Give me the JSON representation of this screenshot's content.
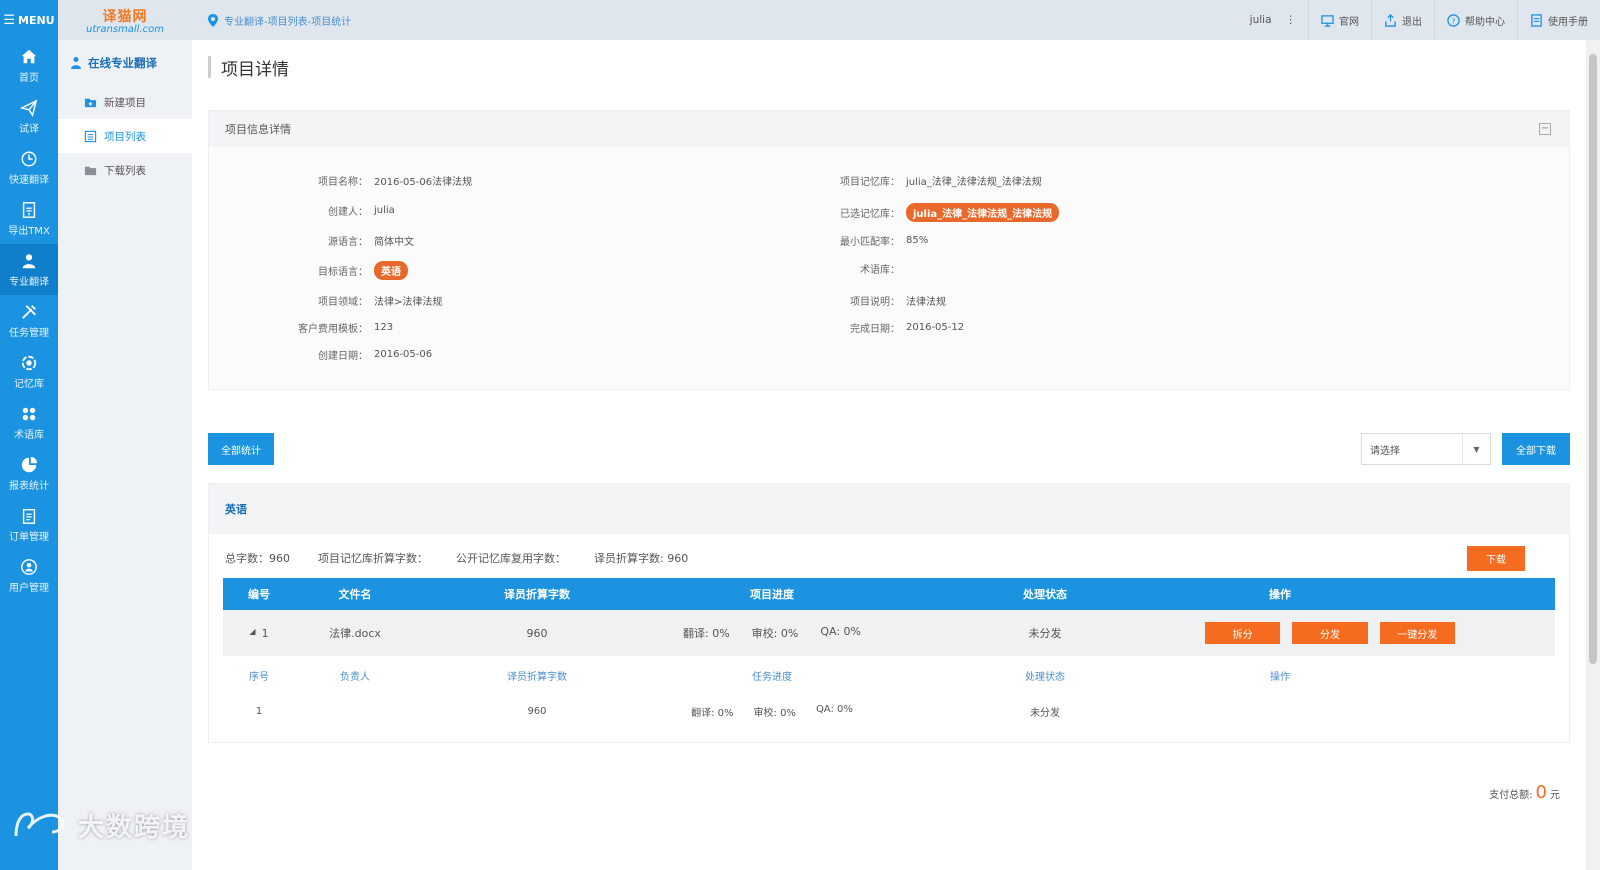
{
  "menu_label": "MENU",
  "logo": {
    "cn": "译猫网",
    "en": "utransmall.com"
  },
  "breadcrumb": "专业翻译-项目列表-项目统计",
  "topbar": {
    "user": "julia",
    "links": [
      {
        "icon": "monitor-icon",
        "label": "官网"
      },
      {
        "icon": "logout-icon",
        "label": "退出"
      },
      {
        "icon": "help-icon",
        "label": "帮助中心"
      },
      {
        "icon": "manual-icon",
        "label": "使用手册"
      }
    ]
  },
  "rail": [
    {
      "icon": "home-icon",
      "label": "首页"
    },
    {
      "icon": "paper-plane-icon",
      "label": "试译"
    },
    {
      "icon": "clock-icon",
      "label": "快速翻译"
    },
    {
      "icon": "export-icon",
      "label": "导出TMX"
    },
    {
      "icon": "translator-icon",
      "label": "专业翻译",
      "active": true
    },
    {
      "icon": "tools-icon",
      "label": "任务管理"
    },
    {
      "icon": "memory-icon",
      "label": "记忆库"
    },
    {
      "icon": "terms-icon",
      "label": "术语库"
    },
    {
      "icon": "pie-chart-icon",
      "label": "报表统计"
    },
    {
      "icon": "clipboard-icon",
      "label": "订单管理"
    },
    {
      "icon": "user-icon",
      "label": "用户管理"
    }
  ],
  "subnav": {
    "title": "在线专业翻译",
    "items": [
      {
        "icon": "folder-plus-icon",
        "label": "新建项目"
      },
      {
        "icon": "list-icon",
        "label": "项目列表",
        "active": true
      },
      {
        "icon": "folder-icon",
        "label": "下载列表"
      }
    ]
  },
  "page_title": "项目详情",
  "panel_title": "项目信息详情",
  "info": {
    "name_label": "项目名称：",
    "name": "2016-05-06法律法规",
    "creator_label": "创建人：",
    "creator": "julia",
    "source_label": "源语言：",
    "source": "简体中文",
    "target_label": "目标语言：",
    "target": "英语",
    "domain_label": "项目领域：",
    "domain": "法律>法律法规",
    "fee_label": "客户费用模板：",
    "fee": "123",
    "created_label": "创建日期：",
    "created": "2016-05-06",
    "tm_label": "项目记忆库：",
    "tm": "julia_法律_法律法规_法律法规",
    "selected_tm_label": "已选记忆库：",
    "selected_tm": "julia_法律_法律法规_法律法规",
    "match_label": "最小匹配率：",
    "match": "85%",
    "termbase_label": "术语库：",
    "termbase": "",
    "desc_label": "项目说明：",
    "desc": "法律法规",
    "done_label": "完成日期：",
    "done": "2016-05-12"
  },
  "buttons": {
    "stats": "全部统计",
    "download_all": "全部下载",
    "download": "下载"
  },
  "select_placeholder": "请选择",
  "lang_block": {
    "title": "英语",
    "summary": [
      "总字数：960",
      "项目记忆库折算字数：",
      "公开记忆库复用字数：",
      "译员折算字数: 960"
    ]
  },
  "table": {
    "headers": [
      "编号",
      "文件名",
      "译员折算字数",
      "项目进度",
      "处理状态",
      "操作"
    ],
    "row": {
      "index": "1",
      "file": "法律.docx",
      "count": "960",
      "progress": [
        "翻译: 0%",
        "审校: 0%",
        "QA: 0%"
      ],
      "status": "未分发",
      "ops": [
        "拆分",
        "分发",
        "一键分发"
      ]
    },
    "sub_headers": [
      "序号",
      "负责人",
      "译员折算字数",
      "任务进度",
      "处理状态",
      "操作"
    ],
    "sub_row": {
      "index": "1",
      "owner": "",
      "count": "960",
      "progress": [
        "翻译: 0%",
        "审校: 0%",
        "QA: 0%"
      ],
      "status": "未分发"
    }
  },
  "total": {
    "label": "支付总额:",
    "amount": "0",
    "unit": "元"
  },
  "watermark": "大数跨境"
}
